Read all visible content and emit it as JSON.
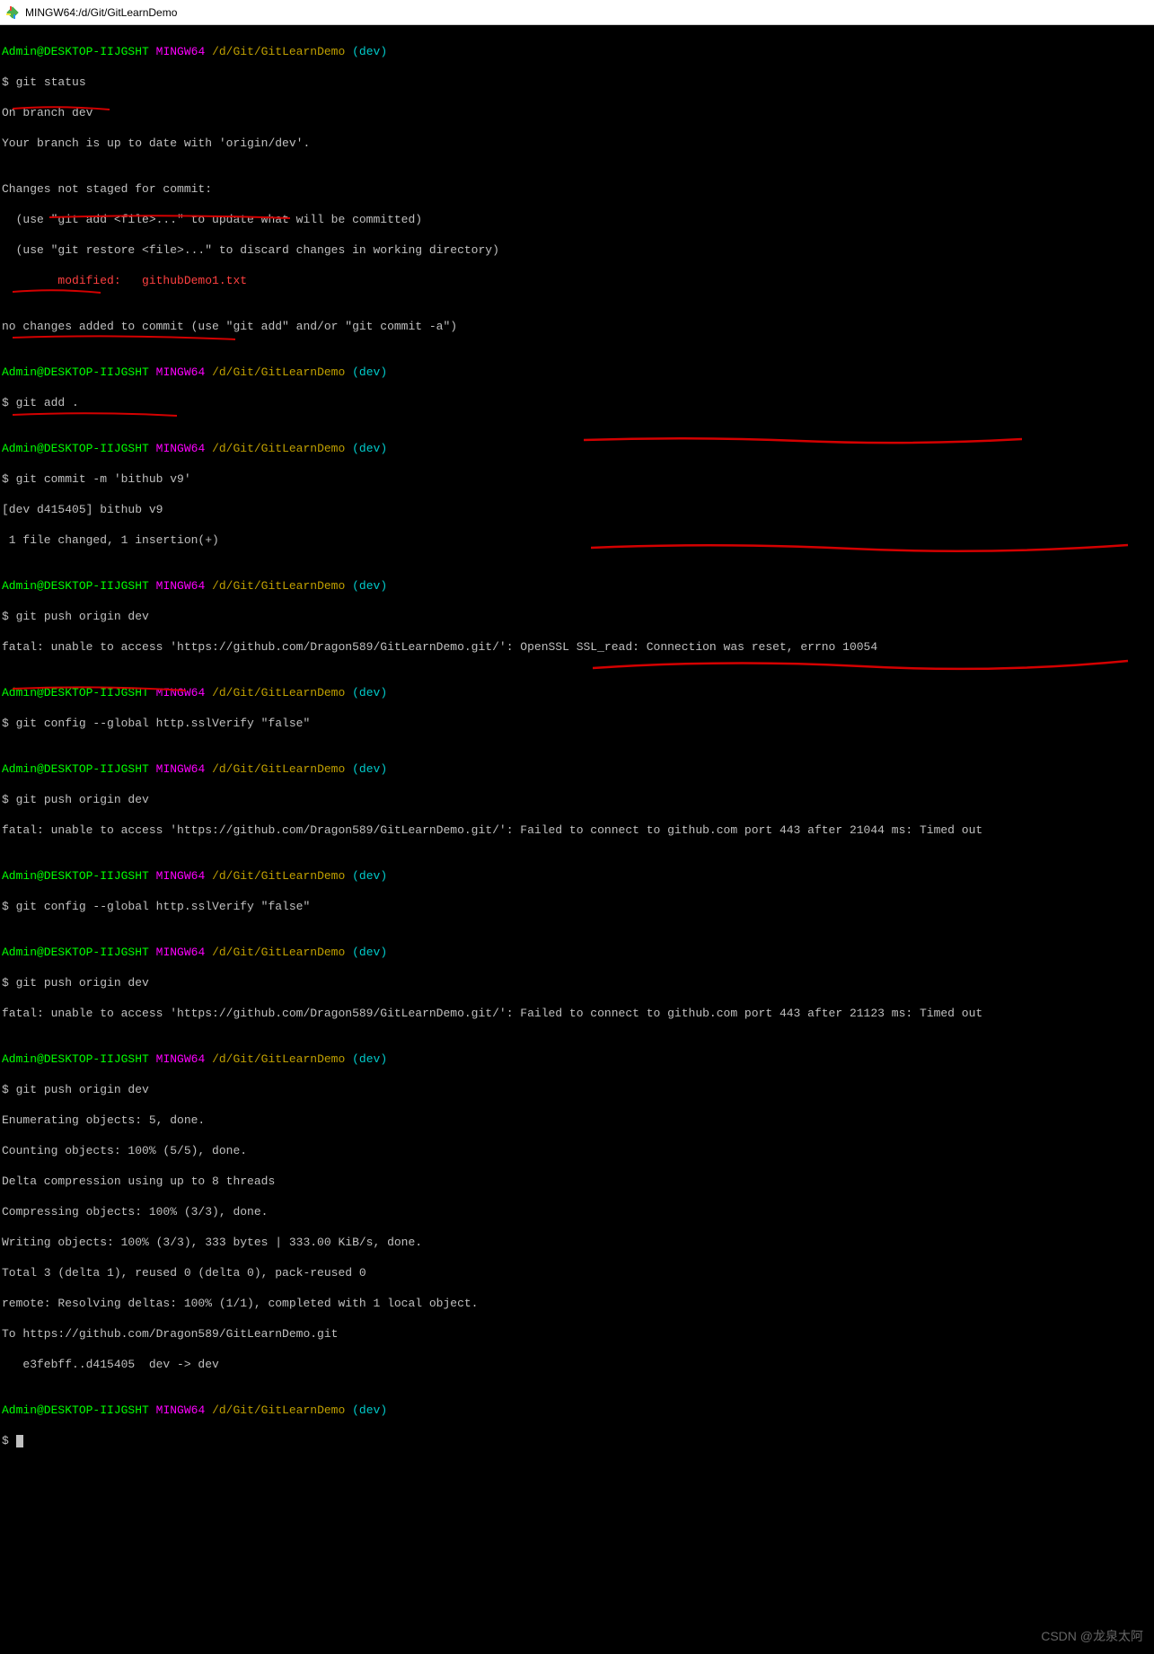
{
  "window": {
    "title": "MINGW64:/d/Git/GitLearnDemo"
  },
  "prompt": {
    "user": "Admin@DESKTOP-IIJGSHT",
    "shell": "MINGW64",
    "path": "/d/Git/GitLearnDemo",
    "branch_open": "(",
    "branch": "dev",
    "branch_close": ")",
    "sigil": "$ "
  },
  "lines": {
    "cmd_status": "git status",
    "on_branch": "On branch dev",
    "up_to_date": "Your branch is up to date with 'origin/dev'.",
    "blank": "",
    "changes_hdr": "Changes not staged for commit:",
    "hint_add": "  (use \"git add <file>...\" to update what will be committed)",
    "hint_restore": "  (use \"git restore <file>...\" to discard changes in working directory)",
    "modified": "        modified:   githubDemo1.txt",
    "no_changes": "no changes added to commit (use \"git add\" and/or \"git commit -a\")",
    "cmd_add": "git add .",
    "cmd_commit": "git commit -m 'bithub v9'",
    "commit_out1": "[dev d415405] bithub v9",
    "commit_out2": " 1 file changed, 1 insertion(+)",
    "cmd_push": "git push origin dev",
    "fatal_ssl": "fatal: unable to access 'https://github.com/Dragon589/GitLearnDemo.git/': OpenSSL SSL_read: Connection was reset, errno 10054",
    "cmd_sslcfg": "git config --global http.sslVerify \"false\"",
    "fatal_timeout1": "fatal: unable to access 'https://github.com/Dragon589/GitLearnDemo.git/': Failed to connect to github.com port 443 after 21044 ms: Timed out",
    "fatal_timeout2": "fatal: unable to access 'https://github.com/Dragon589/GitLearnDemo.git/': Failed to connect to github.com port 443 after 21123 ms: Timed out",
    "push_ok1": "Enumerating objects: 5, done.",
    "push_ok2": "Counting objects: 100% (5/5), done.",
    "push_ok3": "Delta compression using up to 8 threads",
    "push_ok4": "Compressing objects: 100% (3/3), done.",
    "push_ok5": "Writing objects: 100% (3/3), 333 bytes | 333.00 KiB/s, done.",
    "push_ok6": "Total 3 (delta 1), reused 0 (delta 0), pack-reused 0",
    "push_ok7": "remote: Resolving deltas: 100% (1/1), completed with 1 local object.",
    "push_ok8": "To https://github.com/Dragon589/GitLearnDemo.git",
    "push_ok9": "   e3febff..d415405  dev -> dev"
  },
  "watermark": "CSDN @龙泉太阿"
}
